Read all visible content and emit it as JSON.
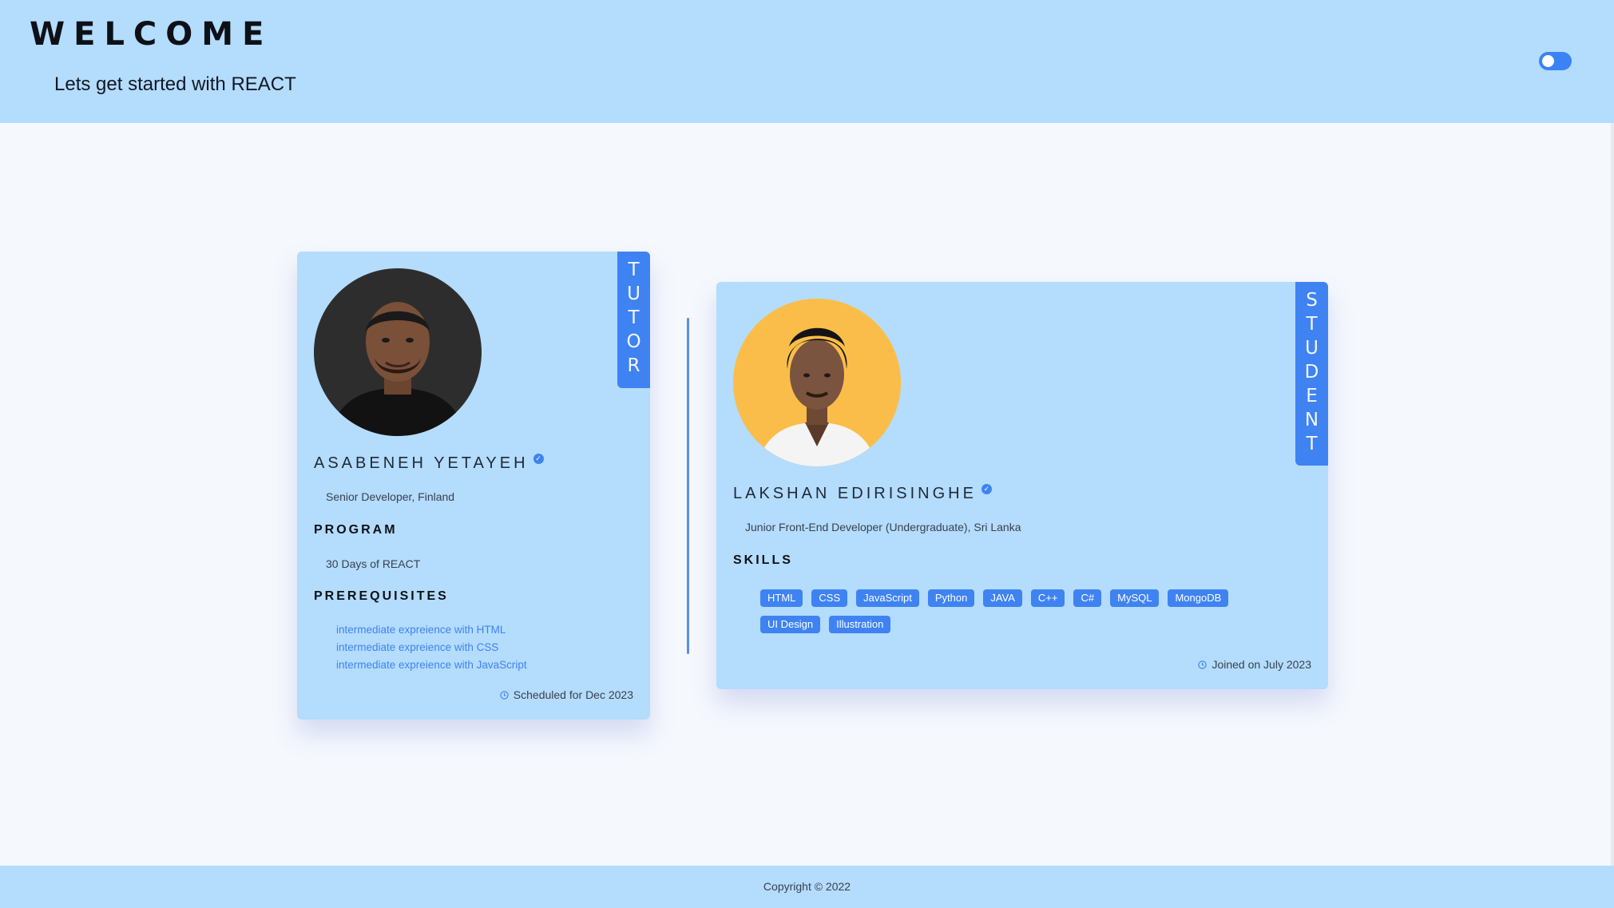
{
  "header": {
    "title": "WELCOME",
    "subtitle": "Lets get started with REACT",
    "theme_toggle": "theme-toggle"
  },
  "tutor": {
    "ribbon": [
      "T",
      "U",
      "T",
      "O",
      "R"
    ],
    "name": "ASABENEH YETAYEH",
    "role": "Senior Developer, Finland",
    "program_heading": "PROGRAM",
    "program": "30 Days of REACT",
    "prereq_heading": "PREREQUISITES",
    "prerequisites": [
      "intermediate expreience with HTML",
      "intermediate expreience with CSS",
      "intermediate expreience with JavaScript"
    ],
    "schedule": "Scheduled for Dec 2023",
    "icons": {
      "verified": "verified-badge-icon",
      "meta": "clock-icon"
    }
  },
  "student": {
    "ribbon": [
      "S",
      "T",
      "U",
      "D",
      "E",
      "N",
      "T"
    ],
    "name": "LAKSHAN EDIRISINGHE",
    "role": "Junior Front-End Developer (Undergraduate), Sri Lanka",
    "skills_heading": "SKILLS",
    "skills": [
      "HTML",
      "CSS",
      "JavaScript",
      "Python",
      "JAVA",
      "C++",
      "C#",
      "MySQL",
      "MongoDB",
      "UI Design",
      "Illustration"
    ],
    "joined": "Joined on July 2023",
    "icons": {
      "verified": "verified-badge-icon",
      "meta": "clock-icon"
    }
  },
  "footer": {
    "copyright": "Copyright © 2022"
  },
  "colors": {
    "header_bg": "#b4dcfc",
    "page_bg": "#f5f8fd",
    "accent": "#3f83f2",
    "card_bg": "#b4dcfc",
    "student_avatar_bg": "#fbbd49",
    "tutor_avatar_bg": "#2b2b2b"
  }
}
